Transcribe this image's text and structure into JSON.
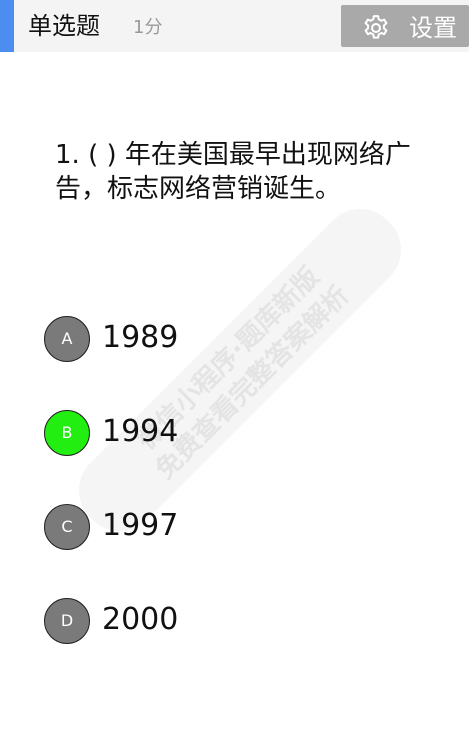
{
  "header": {
    "question_type": "单选题",
    "score": "1分",
    "settings_label": "设置"
  },
  "question": {
    "text": "1. (      ) 年在美国最早出现网络广告，标志网络营销诞生。"
  },
  "options": [
    {
      "letter": "A",
      "text": "1989",
      "selected": false
    },
    {
      "letter": "B",
      "text": "1994",
      "selected": true
    },
    {
      "letter": "C",
      "text": "1997",
      "selected": false
    },
    {
      "letter": "D",
      "text": "2000",
      "selected": false
    }
  ],
  "watermark": {
    "line1": "微信小程序·题库新版",
    "line2": "免费查看完整答案解析"
  },
  "colors": {
    "accent": "#4b8ef0",
    "selected": "#22ee11",
    "unselected": "#7a7a7a",
    "settings_bg": "#a9a9a9"
  },
  "icons": {
    "settings": "gear-icon"
  }
}
